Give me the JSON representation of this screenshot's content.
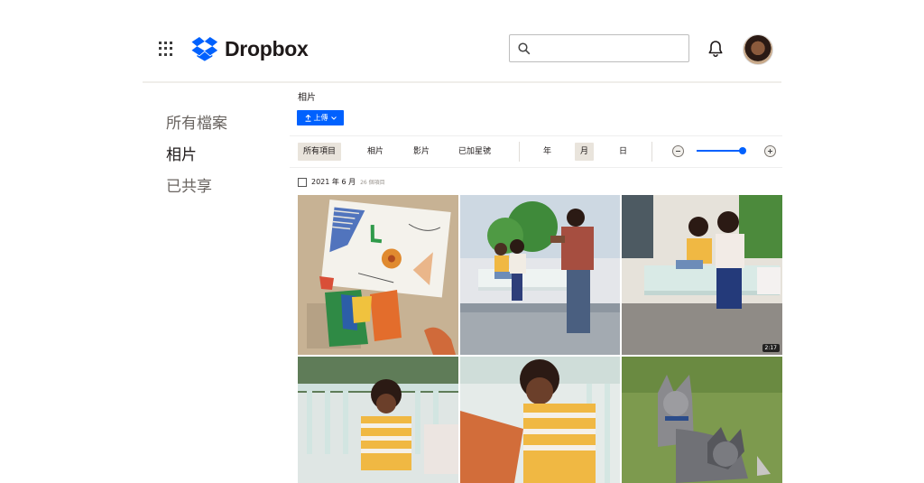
{
  "app": {
    "brand": "Dropbox"
  },
  "header": {
    "search_placeholder": ""
  },
  "sidebar": {
    "items": [
      {
        "label": "所有檔案"
      },
      {
        "label": "相片"
      },
      {
        "label": "已共享"
      }
    ]
  },
  "main": {
    "breadcrumb": "相片",
    "upload_label": "上傳",
    "filters": [
      "所有項目",
      "相片",
      "影片",
      "已加星號"
    ],
    "views": [
      "年",
      "月",
      "日"
    ],
    "selected_filter": "所有項目",
    "selected_view": "月",
    "group": {
      "date": "2021 年 6 月",
      "count": "26 個項目"
    },
    "photos": [
      {
        "name": "artwork"
      },
      {
        "name": "family-swing"
      },
      {
        "name": "mother-son-swing",
        "duration": "2:17"
      },
      {
        "name": "boy-bench"
      },
      {
        "name": "boy-smiling"
      },
      {
        "name": "dogs"
      }
    ]
  },
  "colors": {
    "accent": "#0061fe",
    "text": "#1e1919",
    "chip_selected": "#e9e4dc"
  }
}
